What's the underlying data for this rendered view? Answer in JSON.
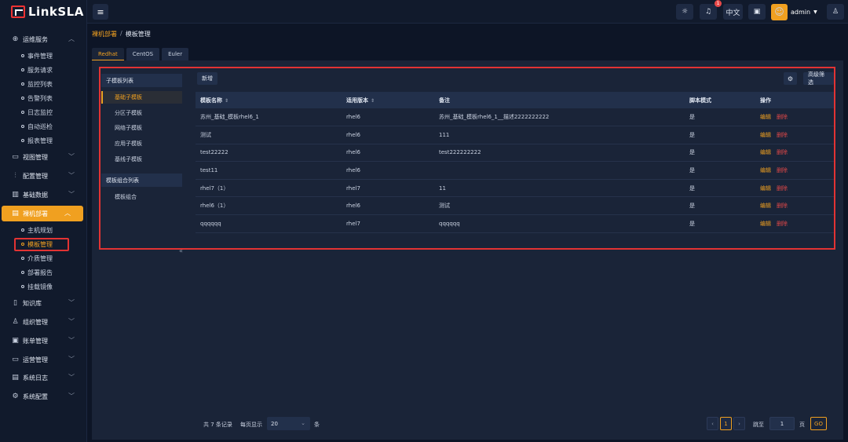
{
  "app": {
    "logo_text": "LinkSLA"
  },
  "sidebar": {
    "groups": [
      {
        "label": "运维服务",
        "icon": "globe-icon"
      },
      {
        "label": "视图管理",
        "icon": "monitor-icon"
      },
      {
        "label": "配置管理",
        "icon": "sliders-icon"
      },
      {
        "label": "基础数据",
        "icon": "bar-chart-icon"
      },
      {
        "label": "裸机部署",
        "icon": "server-icon"
      },
      {
        "label": "知识库",
        "icon": "book-icon"
      },
      {
        "label": "组织管理",
        "icon": "user-icon"
      },
      {
        "label": "账单管理",
        "icon": "bill-icon"
      },
      {
        "label": "运营管理",
        "icon": "operations-icon"
      },
      {
        "label": "系统日志",
        "icon": "log-icon"
      },
      {
        "label": "系统配置",
        "icon": "gear-icon"
      }
    ],
    "ops_items": [
      "事件管理",
      "服务请求",
      "监控列表",
      "告警列表",
      "日志监控",
      "自动巡检",
      "报表管理"
    ],
    "deploy_items": [
      "主机规划",
      "模板管理",
      "介质管理",
      "部署报告",
      "挂载镜像"
    ]
  },
  "topbar": {
    "lang_label": "中文",
    "notification_count": "1",
    "username": "admin"
  },
  "breadcrumb": {
    "parent": "裸机部署",
    "separator": "/",
    "current": "模板管理"
  },
  "os_tabs": [
    "Redhat",
    "CentOS",
    "Euler"
  ],
  "left_panel": {
    "sub_header": "子模板列表",
    "sub_items": [
      "基础子模板",
      "分区子模板",
      "网络子模板",
      "应用子模板",
      "基线子模板"
    ],
    "combo_header": "模板组合列表",
    "combo_items": [
      "模板组合"
    ]
  },
  "toolbar": {
    "add_label": "新增",
    "filter_label": "高级筛选"
  },
  "table": {
    "columns": [
      "模板名称",
      "适用版本",
      "备注",
      "脚本模式",
      "操作"
    ],
    "rows": [
      {
        "name": "苏州_基础_模板rhel6_1",
        "version": "rhel6",
        "remark": "苏州_基础_模板rhel6_1__描述2222222222",
        "script": "是"
      },
      {
        "name": "测试",
        "version": "rhel6",
        "remark": "111",
        "script": "是"
      },
      {
        "name": "test22222",
        "version": "rhel6",
        "remark": "test222222222",
        "script": "是"
      },
      {
        "name": "test11",
        "version": "rhel6",
        "remark": "",
        "script": "是"
      },
      {
        "name": "rhel7（1）",
        "version": "rhel7",
        "remark": "11",
        "script": "是"
      },
      {
        "name": "rhel6（1）",
        "version": "rhel6",
        "remark": "测试",
        "script": "是"
      },
      {
        "name": "qqqqqq",
        "version": "rhel7",
        "remark": "qqqqqq",
        "script": "是"
      }
    ],
    "edit_label": "编辑",
    "delete_label": "删除"
  },
  "pagination": {
    "total_text": "共 7 条记录",
    "per_page_label": "每页显示",
    "page_size": "20",
    "per_unit": "条",
    "current_page": "1",
    "goto_label": "跳至",
    "goto_value": "1",
    "page_unit": "页",
    "go_label": "GO"
  },
  "colors": {
    "accent": "#f0a020",
    "danger": "#e04848",
    "highlight": "#e23333",
    "background": "#0d1526"
  }
}
